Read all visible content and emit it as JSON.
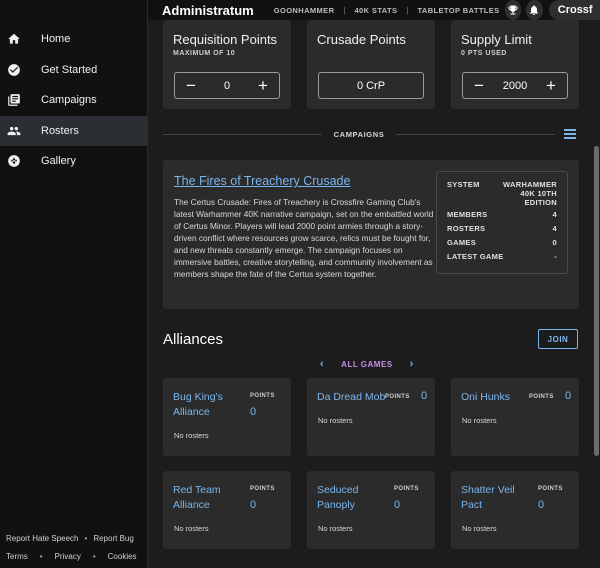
{
  "header": {
    "brand": "Administratum",
    "links": [
      "GOONHAMMER",
      "40K STATS",
      "TABLETOP BATTLES"
    ],
    "separator": "|",
    "icons": [
      "trophy-icon",
      "bell-icon"
    ],
    "user_label": "Crossf"
  },
  "sidebar": {
    "items": [
      {
        "label": "Home",
        "icon": "home-icon"
      },
      {
        "label": "Get Started",
        "icon": "check-circle-icon"
      },
      {
        "label": "Campaigns",
        "icon": "library-icon"
      },
      {
        "label": "Rosters",
        "icon": "people-icon",
        "active": true
      },
      {
        "label": "Gallery",
        "icon": "aperture-icon"
      }
    ],
    "footer": {
      "report_hate": "Report Hate Speech",
      "report_bug": "Report Bug",
      "terms": "Terms",
      "privacy": "Privacy",
      "cookies": "Cookies",
      "dot": "•"
    }
  },
  "points": {
    "requisition": {
      "title": "Requisition Points",
      "subtitle": "MAXIMUM OF 10",
      "value": "0",
      "minus": "−",
      "plus": "+"
    },
    "crusade": {
      "title": "Crusade Points",
      "value": "0 CrP"
    },
    "supply": {
      "title": "Supply Limit",
      "subtitle": "0 PTS USED",
      "value": "2000",
      "minus": "−",
      "plus": "+"
    }
  },
  "campaigns_label": "CAMPAIGNS",
  "campaign": {
    "title": "The Fires of Treachery Crusade",
    "description": "The Certus Crusade: Fires of Treachery is Crossfire Gaming Club's latest Warhammer 40K narrative campaign, set on the embattled world of Certus Minor. Players will lead 2000 point armies through a story-driven conflict where resources grow scarce, relics must be fought for, and new threats constantly emerge. The campaign focuses on immersive battles, creative storytelling, and community involvement as members shape the fate of the Certus system together.",
    "stats": {
      "system_label": "SYSTEM",
      "system_value": "WARHAMMER 40K 10TH EDITION",
      "members_label": "MEMBERS",
      "members_value": "4",
      "rosters_label": "ROSTERS",
      "rosters_value": "4",
      "games_label": "GAMES",
      "games_value": "0",
      "latest_label": "LATEST GAME",
      "latest_value": "-"
    }
  },
  "alliances": {
    "title": "Alliances",
    "join_label": "JOIN",
    "filter_label": "ALL GAMES",
    "prev": "‹",
    "next": "›",
    "points_label": "POINTS",
    "items": [
      {
        "name": "Bug King's Alliance",
        "points": "0",
        "rosters": "No rosters"
      },
      {
        "name": "Da Dread Mob",
        "points": "0",
        "rosters": "No rosters"
      },
      {
        "name": "Oni Hunks",
        "points": "0",
        "rosters": "No rosters"
      },
      {
        "name": "Red Team Alliance",
        "points": "0",
        "rosters": "No rosters"
      },
      {
        "name": "Seduced Panoply",
        "points": "0",
        "rosters": "No rosters"
      },
      {
        "name": "Shatter Veil Pact",
        "points": "0",
        "rosters": "No rosters"
      }
    ]
  },
  "colors": {
    "accent": "#7ab6ee",
    "filter_accent": "#c58ee8",
    "card_bg": "#2b2b2b",
    "page_bg": "#1c1c1c",
    "sidebar_bg": "#111111"
  }
}
